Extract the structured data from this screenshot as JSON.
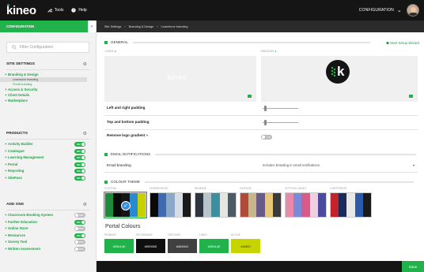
{
  "topbar": {
    "logo": "kineo",
    "tools_label": "Tools",
    "help_label": "Help",
    "config_label": "CONFIGURATION",
    "avatar_alt": "user-avatar"
  },
  "sidebar": {
    "header": "CONFIGURATION",
    "collapse": "‹",
    "search_placeholder": "Filter Configuration",
    "site_settings": {
      "title": "SITE SETTINGS",
      "items": [
        {
          "label": "Branding & Design",
          "subs": [
            "Learnforce branding",
            "Portal branding"
          ]
        },
        {
          "label": "Access & Security"
        },
        {
          "label": "Client Details"
        },
        {
          "label": "Marketplace"
        }
      ]
    },
    "products": {
      "title": "PRODUCTS",
      "items": [
        {
          "label": "Activity Builder",
          "toggle": "ON",
          "on": true
        },
        {
          "label": "Catalogue",
          "toggle": "ON",
          "on": true
        },
        {
          "label": "Learning Management",
          "toggle": "ON",
          "on": true
        },
        {
          "label": "Portal",
          "toggle": "ON",
          "on": true
        },
        {
          "label": "Reporting",
          "toggle": "ON",
          "on": true
        },
        {
          "label": "SitePass",
          "toggle": "ON",
          "on": true
        }
      ]
    },
    "add_ons": {
      "title": "ADD ONS",
      "items": [
        {
          "label": "Classroom Booking System",
          "toggle": "OFF",
          "on": false
        },
        {
          "label": "Further Education",
          "toggle": "ON",
          "on": true
        },
        {
          "label": "Online Store",
          "toggle": "OFF",
          "on": false
        },
        {
          "label": "Resources",
          "toggle": "ON",
          "on": true
        },
        {
          "label": "Survey Tool",
          "toggle": "OFF",
          "on": false
        },
        {
          "label": "Written Assessment",
          "toggle": "OFF",
          "on": false
        }
      ]
    }
  },
  "main": {
    "breadcrumb": [
      "Site Settings",
      "›",
      "Branding & Design",
      "›",
      "Learnforce branding"
    ],
    "general_title": "GENERAL",
    "setup_wizard": "Start Setup Wizard",
    "logo_label": "LOGO",
    "favicon_label": "FAVICON",
    "logo_text": "kineo",
    "favicon_text": "k",
    "left_right_padding": "Left and right padding",
    "top_bottom_padding": "Top and bottom padding",
    "remove_gradient": "Remove logo gradient",
    "remove_gradient_toggle": "NO",
    "email_title": "EMAIL NOTIFICATIONS",
    "email_branding": "Email branding",
    "email_branding_value": "Includes branding in email notifications",
    "theme_title": "COLOUR THEME",
    "themes": [
      {
        "name": "CUSTOM",
        "colors": [
          "#1e8a3c",
          "#0a0a0a",
          "#151515",
          "#2a8ad0",
          "#c6d100"
        ],
        "selected": true
      },
      {
        "name": "LEARNFORCE",
        "colors": [
          "#0a0a0a",
          "#3f6ab0",
          "#8aa8c8",
          "#d8dde5",
          "#1a1a1a"
        ],
        "selected": false
      },
      {
        "name": "SEASIDE",
        "colors": [
          "#2c3540",
          "#b8c6cc",
          "#3b8fa0",
          "#e6e6e0",
          "#4b5a64"
        ],
        "selected": false
      },
      {
        "name": "VINTAGE",
        "colors": [
          "#b14a3a",
          "#c9b58a",
          "#6a5a88",
          "#e8c878",
          "#3b3b3b"
        ],
        "selected": false
      },
      {
        "name": "COTTON CANDY",
        "colors": [
          "#e98aa8",
          "#7a8ad8",
          "#d85a8a",
          "#f0d0e0",
          "#4a4aa0"
        ],
        "selected": false
      },
      {
        "name": "CORPORATE",
        "colors": [
          "#c4232c",
          "#1a2a5a",
          "#e8e8e8",
          "#2d5aa8",
          "#1a1a1a"
        ],
        "selected": false
      }
    ],
    "portal_colours_title": "Portal Colours",
    "portal_colours": [
      {
        "label": "PRIMARY",
        "value": "#00b140",
        "color": "#22b24c"
      },
      {
        "label": "SECONDARY",
        "value": "#000000",
        "color": "#0f0f0f"
      },
      {
        "label": "TERTIARY",
        "value": "#404041",
        "color": "#404041"
      },
      {
        "label": "LINKS",
        "value": "#00b140",
        "color": "#22b24c"
      },
      {
        "label": "ACTIVE",
        "value": "#d0f00",
        "color": "#c6d400"
      }
    ],
    "portal_colours_row2": [
      {
        "label": "HEADER",
        "value": "#000000",
        "color": "#0f0f0f"
      },
      {
        "label": "SUBLINKS",
        "value": "#000000",
        "color": "#0f0f0f"
      },
      {
        "label": "BREADCRUMBS",
        "value": "#404041",
        "color": "#404041"
      },
      {
        "label": "HOVER",
        "value": "#0849b",
        "color": "#1f6aa8"
      },
      {
        "label": "LOGO",
        "value": "#000000",
        "color": "#0f0f0f"
      }
    ],
    "save_label": "Save"
  }
}
